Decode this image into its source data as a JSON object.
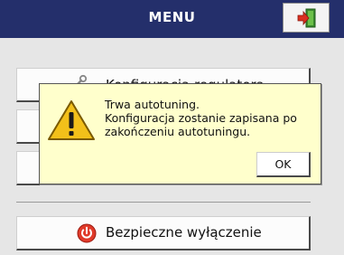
{
  "header": {
    "title": "MENU"
  },
  "menu": {
    "items": [
      {
        "label": "Konfiguracja regulatora",
        "icon": "wrench-icon"
      },
      {
        "label": ""
      },
      {
        "label": ""
      }
    ],
    "shutdown_label": "Bezpieczne wyłączenie"
  },
  "dialog": {
    "message": "Trwa autotuning.\nKonfiguracja zostanie zapisana po\nzakończeniu autotuningu.",
    "ok_label": "OK",
    "icon": "warning-icon"
  },
  "colors": {
    "header_bg": "#242f6b",
    "dialog_bg": "#ffffcc",
    "warning": "#f2c01a",
    "power": "#e03a2a"
  }
}
